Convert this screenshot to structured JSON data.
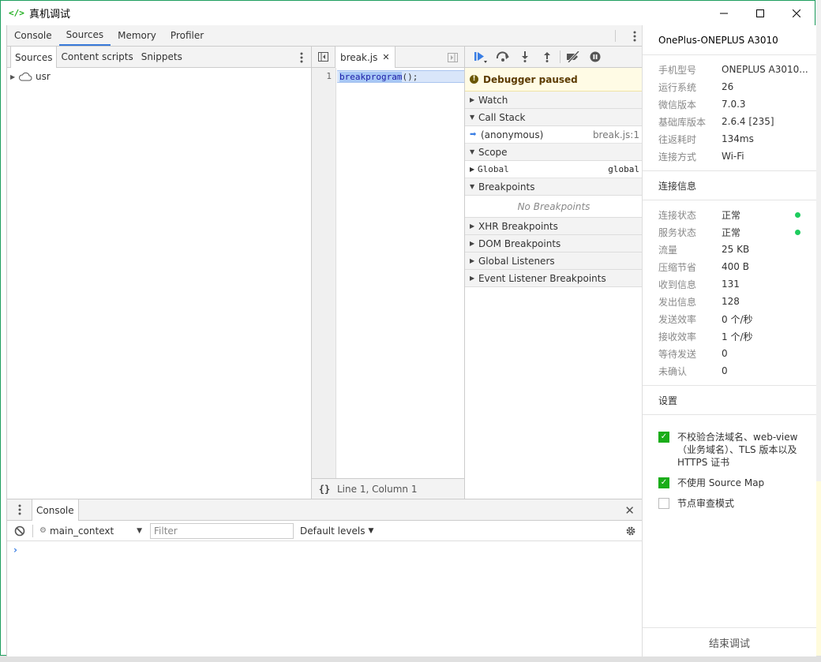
{
  "window": {
    "title": "真机调试"
  },
  "main_tabs": [
    {
      "label": "Console"
    },
    {
      "label": "Sources"
    },
    {
      "label": "Memory"
    },
    {
      "label": "Profiler"
    }
  ],
  "navigator": {
    "tabs": [
      {
        "label": "Sources"
      },
      {
        "label": "Content scripts"
      },
      {
        "label": "Snippets"
      }
    ],
    "tree": [
      {
        "label": "usr"
      }
    ]
  },
  "editor": {
    "file_tab": "break.js",
    "line_number": "1",
    "code": {
      "fn": "breakprogram",
      "rest": "();"
    },
    "status": "Line 1, Column 1",
    "pretty_print": "{}"
  },
  "debugger": {
    "paused_message": "Debugger paused",
    "sections": {
      "watch": "Watch",
      "call_stack": "Call Stack",
      "scope": "Scope",
      "breakpoints": "Breakpoints",
      "xhr": "XHR Breakpoints",
      "dom": "DOM Breakpoints",
      "global_listeners": "Global Listeners",
      "event_listeners": "Event Listener Breakpoints"
    },
    "call_stack": [
      {
        "fn": "(anonymous)",
        "location": "break.js:1"
      }
    ],
    "scope": [
      {
        "name": "Global",
        "value": "global"
      }
    ],
    "no_breakpoints": "No Breakpoints"
  },
  "console": {
    "tab": "Console",
    "context": "main_context",
    "filter_placeholder": "Filter",
    "levels": "Default levels",
    "prompt": "›"
  },
  "info_panel": {
    "device": "OnePlus-ONEPLUS A3010",
    "device_info": [
      {
        "k": "手机型号",
        "v": "ONEPLUS A3010..."
      },
      {
        "k": "运行系统",
        "v": "26"
      },
      {
        "k": "微信版本",
        "v": "7.0.3"
      },
      {
        "k": "基础库版本",
        "v": "2.6.4 [235]"
      },
      {
        "k": "往返耗时",
        "v": "134ms"
      },
      {
        "k": "连接方式",
        "v": "Wi-Fi"
      }
    ],
    "conn_title": "连接信息",
    "conn_info": [
      {
        "k": "连接状态",
        "v": "正常"
      },
      {
        "k": "服务状态",
        "v": "正常"
      },
      {
        "k": "流量",
        "v": "25 KB"
      },
      {
        "k": "压缩节省",
        "v": "400 B"
      },
      {
        "k": "收到信息",
        "v": "131"
      },
      {
        "k": "发出信息",
        "v": "128"
      },
      {
        "k": "发送效率",
        "v": "0 个/秒"
      },
      {
        "k": "接收效率",
        "v": "1 个/秒"
      },
      {
        "k": "等待发送",
        "v": "0"
      },
      {
        "k": "未确认",
        "v": "0"
      }
    ],
    "status_color": "#1ecc5e",
    "settings_title": "设置",
    "settings": [
      {
        "label": "不校验合法域名、web-view（业务域名）、TLS 版本以及 HTTPS 证书",
        "checked": true
      },
      {
        "label": "不使用 Source Map",
        "checked": true
      },
      {
        "label": "节点审查模式",
        "checked": false
      }
    ],
    "end_button": "结束调试"
  }
}
